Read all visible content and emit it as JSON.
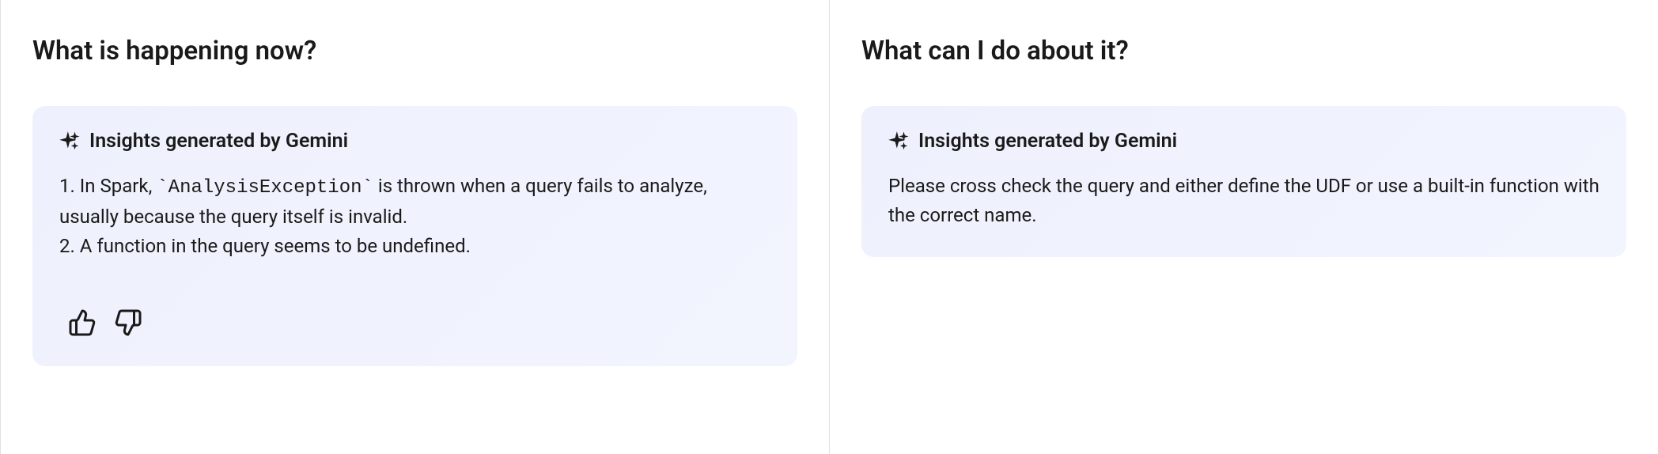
{
  "left": {
    "title": "What is happening now?",
    "insight_label": "Insights generated by Gemini",
    "body_line1_prefix": "1. In Spark, ",
    "body_line1_code": "`AnalysisException`",
    "body_line1_suffix": " is thrown when a query fails to analyze, usually because the query itself is invalid.",
    "body_line2": "2. A function in the query seems to be undefined."
  },
  "right": {
    "title": "What can I do about it?",
    "insight_label": "Insights generated by Gemini",
    "body": "Please cross check the query and either define the UDF or use a built-in function with the correct name."
  }
}
